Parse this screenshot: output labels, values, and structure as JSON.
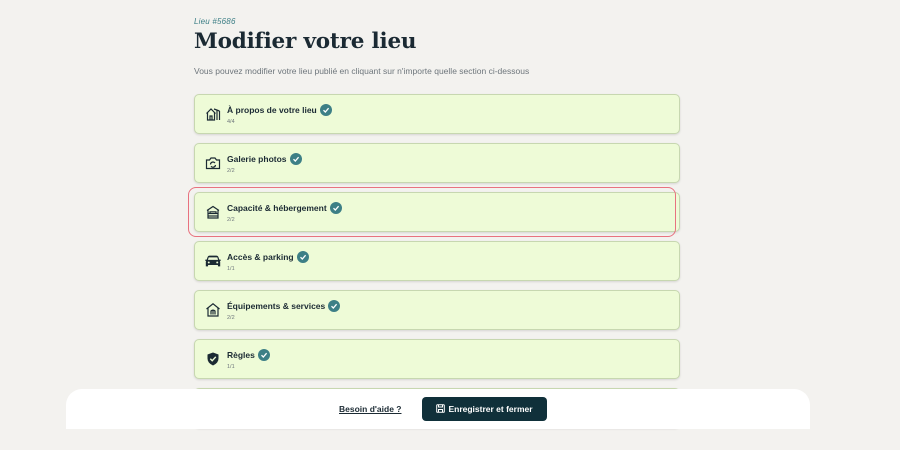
{
  "header": {
    "lieu_id": "Lieu #5686",
    "title": "Modifier votre lieu",
    "subtitle": "Vous pouvez modifier votre lieu publié en cliquant sur n'importe quelle section ci-dessous"
  },
  "sections": [
    {
      "title": "À propos de votre lieu",
      "count": "4/4",
      "icon": "house-icon",
      "completed": true
    },
    {
      "title": "Galerie photos",
      "count": "2/2",
      "icon": "photo-icon",
      "completed": true
    },
    {
      "title": "Capacité & hébergement",
      "count": "2/2",
      "icon": "bed-icon",
      "completed": true,
      "highlighted": true
    },
    {
      "title": "Accès & parking",
      "count": "1/1",
      "icon": "car-icon",
      "completed": true
    },
    {
      "title": "Équipements & services",
      "count": "2/2",
      "icon": "amenities-icon",
      "completed": true
    },
    {
      "title": "Règles",
      "count": "1/1",
      "icon": "shield-check-icon",
      "completed": true
    }
  ],
  "footer": {
    "help_label": "Besoin d'aide ?",
    "save_label": "Enregistrer et fermer",
    "save_icon": "save-icon"
  },
  "colors": {
    "card_background": "#eefbd7",
    "check_badge": "#3d7f86",
    "primary_button": "#10303a",
    "highlight_border": "#e8727f"
  }
}
